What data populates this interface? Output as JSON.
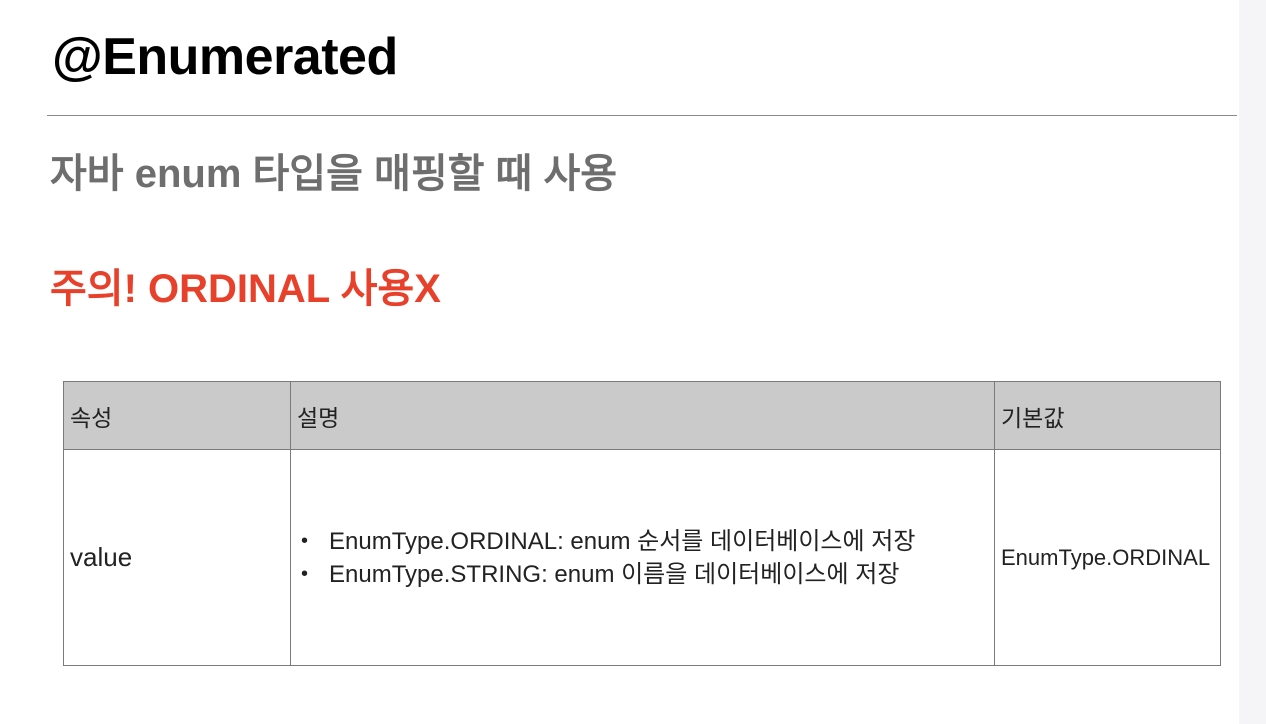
{
  "slide": {
    "title": "@Enumerated",
    "subtitle": "자바 enum 타입을 매핑할 때 사용",
    "warning": "주의! ORDINAL 사용X"
  },
  "table": {
    "headers": {
      "attribute": "속성",
      "description": "설명",
      "default": "기본값"
    },
    "rows": [
      {
        "attribute": "value",
        "description": [
          "EnumType.ORDINAL: enum 순서를 데이터베이스에 저장",
          "EnumType.STRING: enum 이름을 데이터베이스에 저장"
        ],
        "default": "EnumType.ORDINAL"
      }
    ],
    "bullet_glyph": "•"
  },
  "colors": {
    "subtitle": "#6e6e6e",
    "warning": "#e8412b",
    "header_bg": "#cacaca"
  }
}
